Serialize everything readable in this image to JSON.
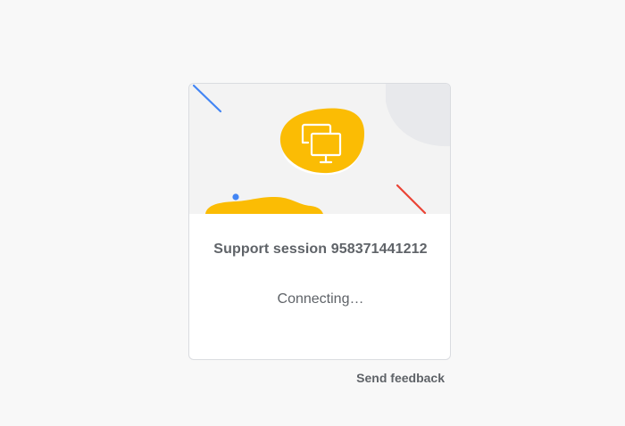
{
  "session": {
    "title": "Support session 958371441212",
    "status": "Connecting…"
  },
  "footer": {
    "feedback_label": "Send feedback"
  },
  "icons": {
    "hero": "screen-share-icon"
  },
  "colors": {
    "accent_yellow": "#fbbc04",
    "accent_blue": "#4285f4",
    "accent_red": "#ea4335",
    "text_gray": "#5f6368",
    "illustration_bg": "#f3f3f3"
  }
}
